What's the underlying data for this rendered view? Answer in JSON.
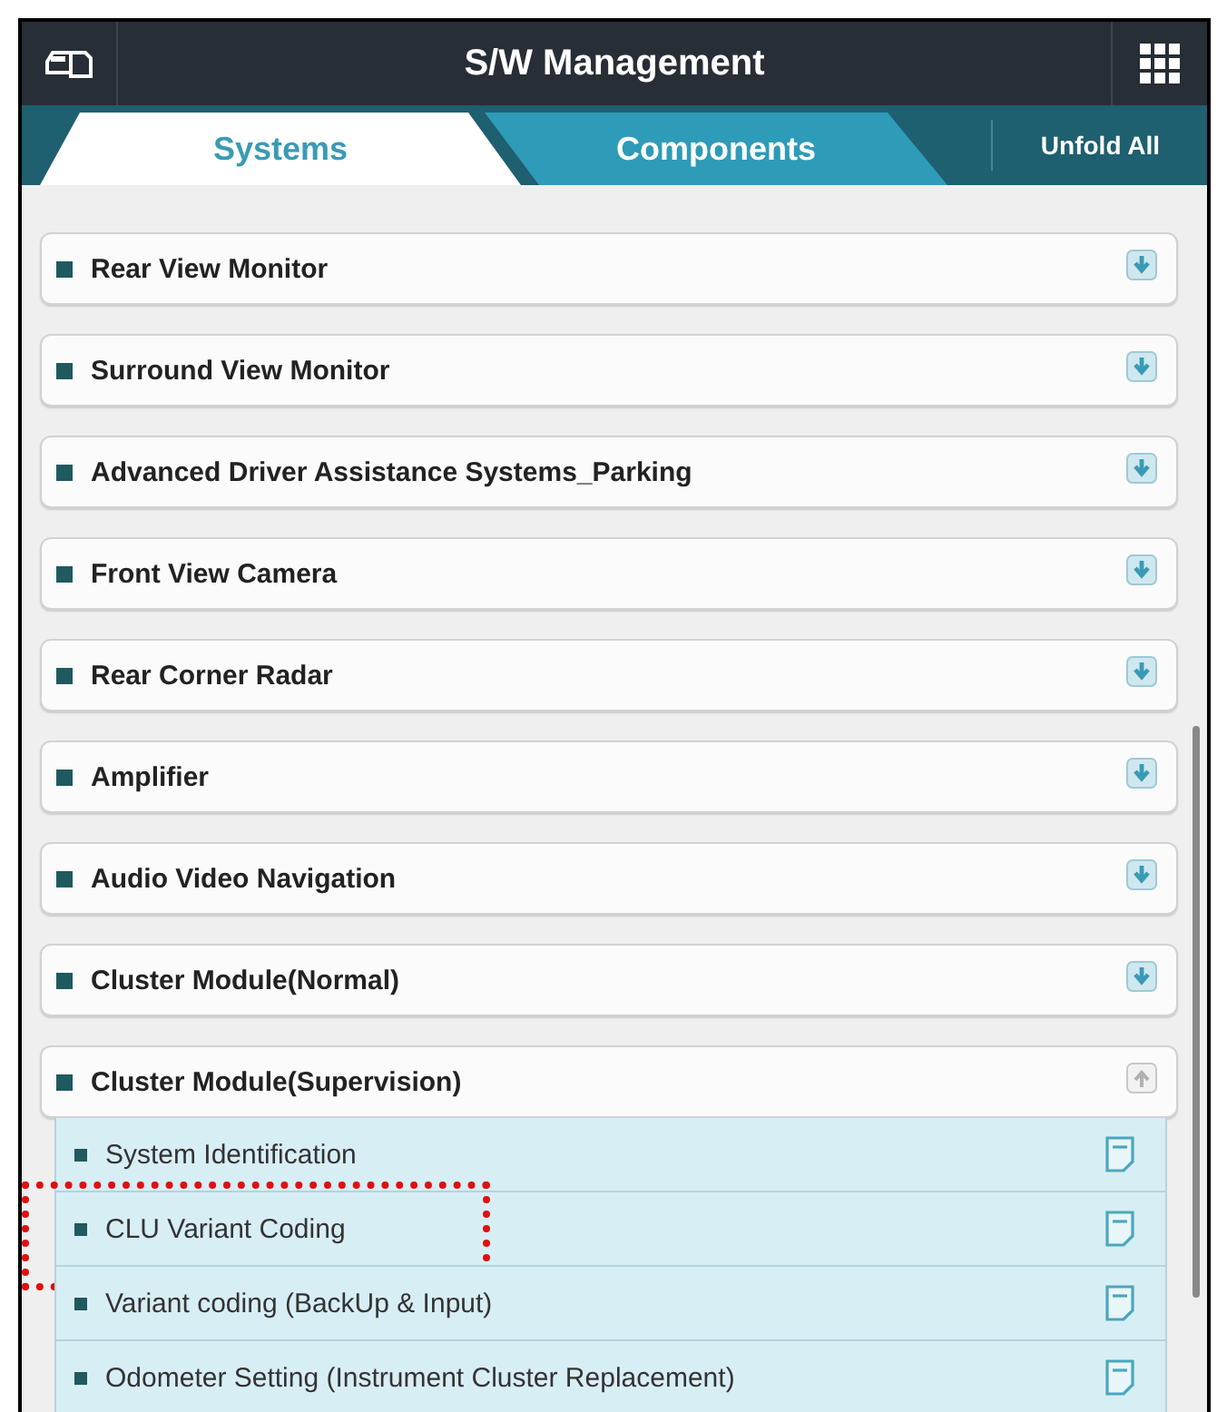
{
  "header": {
    "title": "S/W Management"
  },
  "tabs": [
    {
      "label": "Systems",
      "selected": true
    },
    {
      "label": "Components",
      "selected": false
    }
  ],
  "unfold_all": "Unfold All",
  "systems": [
    {
      "name": "Rear View Monitor",
      "expanded": false
    },
    {
      "name": "Surround View Monitor",
      "expanded": false
    },
    {
      "name": "Advanced Driver Assistance Systems_Parking",
      "expanded": false
    },
    {
      "name": "Front View Camera",
      "expanded": false
    },
    {
      "name": "Rear Corner Radar",
      "expanded": false
    },
    {
      "name": "Amplifier",
      "expanded": false
    },
    {
      "name": "Audio Video Navigation",
      "expanded": false
    },
    {
      "name": "Cluster Module(Normal)",
      "expanded": false
    },
    {
      "name": "Cluster Module(Supervision)",
      "expanded": true,
      "children": [
        {
          "name": "System Identification",
          "highlighted": false
        },
        {
          "name": "CLU Variant Coding",
          "highlighted": true
        },
        {
          "name": "Variant coding (BackUp & Input)",
          "highlighted": false
        },
        {
          "name": "Odometer Setting (Instrument Cluster Replacement)",
          "highlighted": false
        }
      ]
    }
  ]
}
